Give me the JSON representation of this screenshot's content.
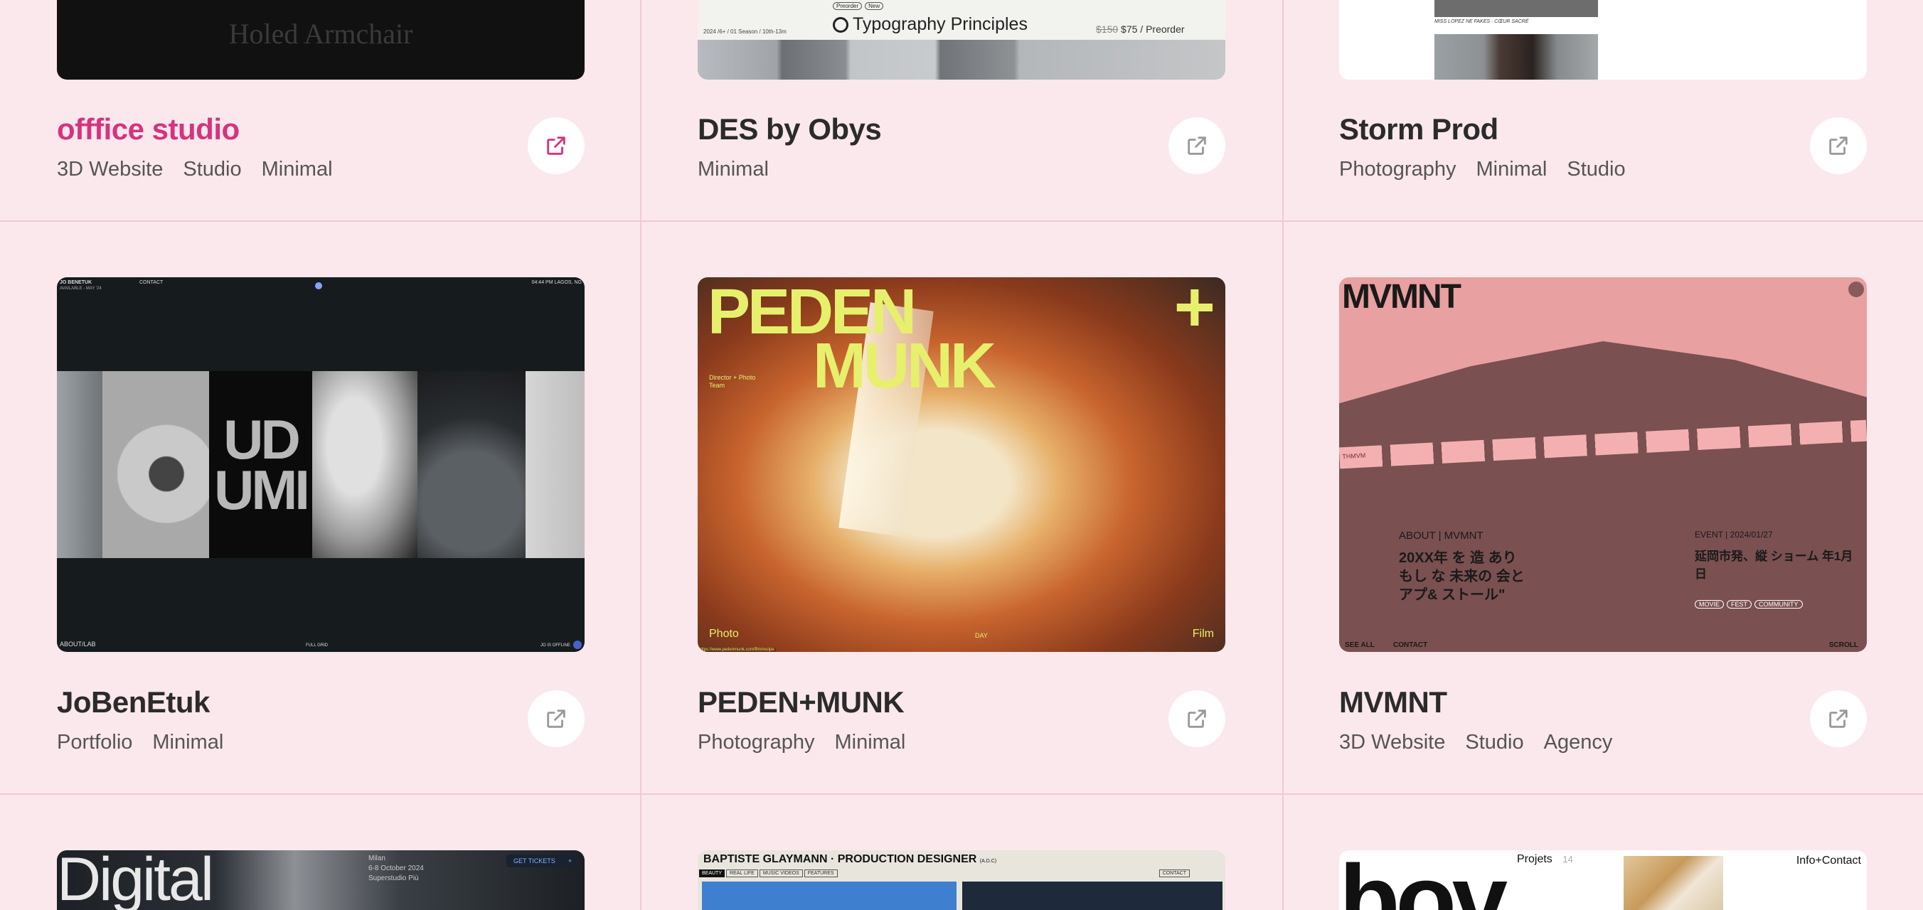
{
  "colors": {
    "page_bg": "#fbe8ec",
    "divider": "#f2c9d1",
    "accent": "#d6337e",
    "title": "#2b2b2b",
    "tag": "#555555"
  },
  "cards": [
    {
      "title": "offfice studio",
      "tags": [
        "3D Website",
        "Studio",
        "Minimal"
      ],
      "thumb_text": "Holed Armchair",
      "icon": "external-link-icon",
      "active": true
    },
    {
      "title": "DES by Obys",
      "tags": [
        "Minimal"
      ],
      "thumb": {
        "badges": [
          "Preorder",
          "New"
        ],
        "meta": "2024 /6+ / 01 Season / 10th-13m",
        "heading": "Typography Principles",
        "old_price": "$150",
        "price": "$75 / Preorder"
      },
      "icon": "external-link-icon"
    },
    {
      "title": "Storm Prod",
      "tags": [
        "Photography",
        "Minimal",
        "Studio"
      ],
      "thumb": {
        "caption": "MISS LOPEZ  NE FAKES  ·  CŒUR SACRÉ"
      },
      "icon": "external-link-icon"
    },
    {
      "title": "JoBenEtuk",
      "tags": [
        "Portfolio",
        "Minimal"
      ],
      "thumb": {
        "top_left": "JO BENETUK",
        "top_left_sub": "AVAILABLE - MAY '24",
        "top_mid": "CONTACT",
        "top_right": "04:44 PM LAGOS, NG",
        "center_word_1": "UD",
        "center_word_2": "UMI",
        "bottom_left": "ABOUT/LAB",
        "bottom_mid": "FULL  GRID",
        "bottom_right": "JO IS OFFLINE"
      },
      "icon": "external-link-icon"
    },
    {
      "title": "PEDEN+MUNK",
      "tags": [
        "Photography",
        "Minimal"
      ],
      "thumb": {
        "word_1": "PEDEN",
        "word_2": "MUNK",
        "plus": "+",
        "side_note": "Director + Photo Team",
        "bottom_left": "Photo",
        "bottom_mid": "DAY",
        "bottom_right": "Film",
        "url": "https://www.pedenmunk.com/film/recipe"
      },
      "icon": "external-link-icon"
    },
    {
      "title": "MVMNT",
      "tags": [
        "3D Website",
        "Studio",
        "Agency"
      ],
      "thumb": {
        "logo": "MVMNT",
        "about": "ABOUT | MVMNT",
        "event": "EVENT | 2024/01/27",
        "jp_line_1": "20XX年 を 造 あり",
        "jp_line_2": "もし な 未来の 会と",
        "jp_line_3": "アプ& ストール\"",
        "jp_right": "延岡市発、縦 ショーム 年1月 日",
        "pills": [
          "MOVIE",
          "FEST",
          "COMMUNITY"
        ],
        "see_all": "SEE ALL",
        "contact": "CONTACT",
        "scroll": "SCROLL",
        "strip": "THMVM"
      },
      "icon": "external-link-icon"
    },
    {
      "thumb": {
        "big_word": "Digital",
        "meta_1": "Milan",
        "meta_2": "6-8 October 2024",
        "meta_3": "Superstudio Più",
        "cta": "GET TICKETS"
      }
    },
    {
      "thumb": {
        "heading": "BAPTISTE GLAYMANN · PRODUCTION DESIGNER",
        "heading_sub": "(A.D.C)",
        "nav": [
          "BEAUTY",
          "REAL LIFE",
          "MUSIC VIDEOS",
          "FEATURES"
        ],
        "contact": "CONTACT"
      }
    },
    {
      "thumb": {
        "big_word": "bov",
        "projects": "Projets",
        "projects_count": "14",
        "info": "Info+Contact"
      }
    }
  ]
}
